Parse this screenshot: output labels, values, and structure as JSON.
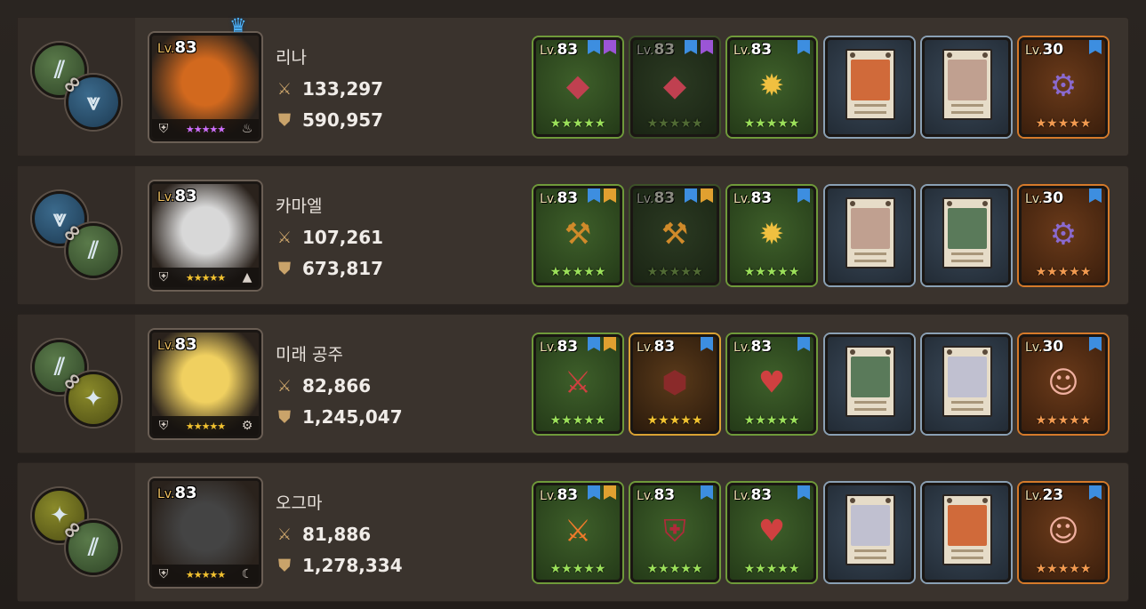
{
  "heroes": [
    {
      "name": "리나",
      "level": "83",
      "lv_label": "Lv.",
      "attack": "133,297",
      "defense": "590,957",
      "stars": "★★★★★",
      "crown": true,
      "emblem_top": "green",
      "emblem_bottom": "blue",
      "portrait_hue": "#d2691e",
      "class_icon": "bow-icon",
      "element_icon": "fire-icon",
      "items": [
        {
          "level": "83",
          "grade": "g-green",
          "flags": [
            "blue",
            "purple"
          ],
          "stars": "★★★★★",
          "kind": "gem"
        },
        {
          "level": "83",
          "grade": "g-dim",
          "flags": [
            "blue",
            "purple"
          ],
          "stars": "★★★★★",
          "kind": "gem"
        },
        {
          "level": "83",
          "grade": "g-green",
          "flags": [
            "blue"
          ],
          "stars": "★★★★★",
          "kind": "amulet"
        },
        {
          "level": "",
          "grade": "g-blue",
          "flags": [],
          "stars": "",
          "kind": "card"
        },
        {
          "level": "",
          "grade": "g-blue",
          "flags": [],
          "stars": "",
          "kind": "card"
        },
        {
          "level": "30",
          "grade": "g-orange",
          "flags": [
            "blue"
          ],
          "stars": "★★★★★",
          "kind": "relic"
        }
      ]
    },
    {
      "name": "카마엘",
      "level": "83",
      "lv_label": "Lv.",
      "attack": "107,261",
      "defense": "673,817",
      "stars": "★★★★★",
      "crown": false,
      "emblem_top": "blue",
      "emblem_bottom": "green",
      "portrait_hue": "#d8d8d8",
      "class_icon": "staff-icon",
      "element_icon": "mountain-icon",
      "items": [
        {
          "level": "83",
          "grade": "g-green",
          "flags": [
            "blue",
            "gold"
          ],
          "stars": "★★★★★",
          "kind": "scythe"
        },
        {
          "level": "83",
          "grade": "g-dim",
          "flags": [
            "blue",
            "gold"
          ],
          "stars": "★★★★★",
          "kind": "scythe"
        },
        {
          "level": "83",
          "grade": "g-green",
          "flags": [
            "blue"
          ],
          "stars": "★★★★★",
          "kind": "amulet"
        },
        {
          "level": "",
          "grade": "g-blue",
          "flags": [],
          "stars": "",
          "kind": "card"
        },
        {
          "level": "",
          "grade": "g-blue",
          "flags": [],
          "stars": "",
          "kind": "card"
        },
        {
          "level": "30",
          "grade": "g-orange",
          "flags": [
            "blue"
          ],
          "stars": "★★★★★",
          "kind": "relic"
        }
      ]
    },
    {
      "name": "미래 공주",
      "level": "83",
      "lv_label": "Lv.",
      "attack": "82,866",
      "defense": "1,245,047",
      "stars": "★★★★★",
      "crown": false,
      "emblem_top": "green",
      "emblem_bottom": "olive",
      "portrait_hue": "#f0d060",
      "class_icon": "shield-icon",
      "element_icon": "gear-icon",
      "items": [
        {
          "level": "83",
          "grade": "g-green",
          "flags": [
            "blue",
            "gold"
          ],
          "stars": "★★★★★",
          "kind": "spear"
        },
        {
          "level": "83",
          "grade": "g-gold",
          "flags": [
            "blue"
          ],
          "stars": "★★★★★",
          "kind": "shield"
        },
        {
          "level": "83",
          "grade": "g-green",
          "flags": [
            "blue"
          ],
          "stars": "★★★★★",
          "kind": "necklace"
        },
        {
          "level": "",
          "grade": "g-blue",
          "flags": [],
          "stars": "",
          "kind": "card"
        },
        {
          "level": "",
          "grade": "g-blue",
          "flags": [],
          "stars": "",
          "kind": "card"
        },
        {
          "level": "30",
          "grade": "g-orange",
          "flags": [
            "blue"
          ],
          "stars": "★★★★★",
          "kind": "face"
        }
      ]
    },
    {
      "name": "오그마",
      "level": "83",
      "lv_label": "Lv.",
      "attack": "81,886",
      "defense": "1,278,334",
      "stars": "★★★★★",
      "crown": false,
      "emblem_top": "olive",
      "emblem_bottom": "green",
      "portrait_hue": "#444444",
      "class_icon": "shield-icon",
      "element_icon": "moon-icon",
      "items": [
        {
          "level": "83",
          "grade": "g-green",
          "flags": [
            "blue",
            "gold"
          ],
          "stars": "★★★★★",
          "kind": "sword"
        },
        {
          "level": "83",
          "grade": "g-green",
          "flags": [
            "blue"
          ],
          "stars": "★★★★★",
          "kind": "armor"
        },
        {
          "level": "83",
          "grade": "g-green",
          "flags": [
            "blue"
          ],
          "stars": "★★★★★",
          "kind": "necklace"
        },
        {
          "level": "",
          "grade": "g-blue",
          "flags": [],
          "stars": "",
          "kind": "card"
        },
        {
          "level": "",
          "grade": "g-blue",
          "flags": [],
          "stars": "",
          "kind": "card"
        },
        {
          "level": "23",
          "grade": "g-orange",
          "flags": [
            "blue"
          ],
          "stars": "★★★★★",
          "kind": "face"
        }
      ]
    }
  ],
  "colors": {
    "emblem_green": "#3e5f2a",
    "emblem_blue": "#2a5272",
    "emblem_olive": "#6a6a1e",
    "row_bg": "#3a332d",
    "stat_text": "#f0ece8"
  },
  "icons": {
    "attack": "crossed-swords-icon",
    "defense": "shield-icon",
    "crown": "crown-icon",
    "link": "chain-icon"
  }
}
